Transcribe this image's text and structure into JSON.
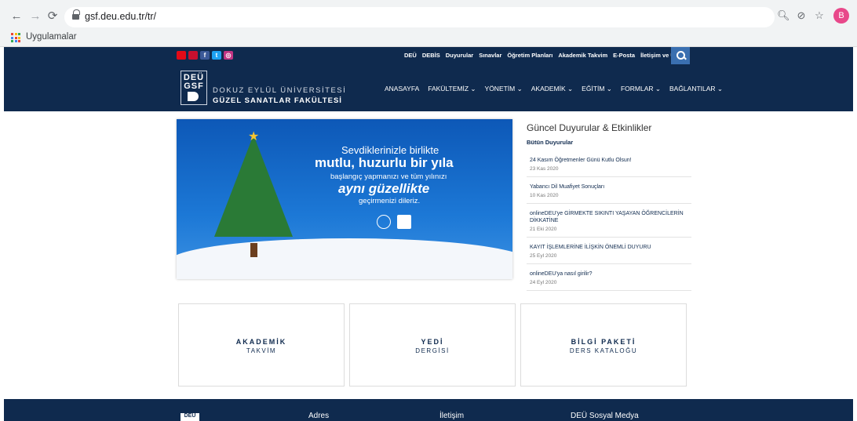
{
  "browser": {
    "url": "gsf.deu.edu.tr/tr/",
    "bookmark": "Uygulamalar",
    "avatar": "B",
    "back": "←",
    "forward": "→",
    "reload": "⟳",
    "icons": [
      "zoom-icon",
      "eye-off-icon",
      "star-icon"
    ]
  },
  "topbar": {
    "social": [
      {
        "icon": "flag-tr-icon",
        "color": "#e30a17",
        "label": ""
      },
      {
        "icon": "flag-en-icon",
        "color": "#c8102e",
        "label": ""
      },
      {
        "icon": "facebook-icon",
        "color": "#3b5998",
        "label": "f"
      },
      {
        "icon": "twitter-icon",
        "color": "#1da1f2",
        "label": "t"
      },
      {
        "icon": "instagram-icon",
        "color": "#c13584",
        "label": "◎"
      }
    ],
    "links": [
      "DEÜ",
      "DEBİS",
      "Duyurular",
      "Sınavlar",
      "Öğretim Planları",
      "Akademik Takvim",
      "E-Posta",
      "İletişim ve Ulaşım"
    ]
  },
  "header": {
    "logo_line1": "DEÜ",
    "logo_line2": "GSF",
    "university": "DOKUZ EYLÜL ÜNİVERSİTESİ",
    "faculty": "GÜZEL SANATLAR FAKÜLTESİ",
    "nav": [
      "ANASAYFA",
      "FAKÜLTEMİZ ⌄",
      "YÖNETİM ⌄",
      "AKADEMİK ⌄",
      "EĞİTİM ⌄",
      "FORMLAR ⌄",
      "BAĞLANTILAR ⌄"
    ]
  },
  "banner": {
    "line1": "Sevdiklerinizle birlikte",
    "line2": "mutlu, huzurlu bir yıla",
    "line3": "başlangıç yapmanızı ve tüm yılınızı",
    "line4": "aynı güzellikte",
    "line5": "geçirmenizi dileriz."
  },
  "news": {
    "title": "Güncel Duyurular & Etkinlikler",
    "all_link": "Bütün Duyurular",
    "items": [
      {
        "title": "24 Kasım Öğretmenler Günü Kutlu Olsun!",
        "date": "23 Kas 2020"
      },
      {
        "title": "Yabancı Dil Muafiyet Sonuçları",
        "date": "10 Kas 2020"
      },
      {
        "title": "onlineDEU'ye GİRMEKTE SIKINTI YAŞAYAN ÖĞRENCİLERİN DİKKATİNE",
        "date": "21 Eki 2020"
      },
      {
        "title": "KAYIT İŞLEMLERİNE İLİŞKİN ÖNEMLİ DUYURU",
        "date": "25 Eyl 2020"
      },
      {
        "title": "onlineDEU'ya nasıl girilir?",
        "date": "24 Eyl 2020"
      }
    ]
  },
  "tiles": [
    {
      "line1": "AKADEMİK",
      "line2": "TAKVİM"
    },
    {
      "line1": "YEDİ",
      "line2": "DERGİSİ"
    },
    {
      "line1": "BİLGİ PAKETİ",
      "line2": "DERS KATALOĞU"
    }
  ],
  "footer": {
    "logo": "DEU",
    "col1": "Adres",
    "col2": "İletişim",
    "col3": "DEÜ Sosyal Medya"
  },
  "colors": {
    "navy": "#0f2a4e",
    "accent": "#3a6fb0"
  }
}
